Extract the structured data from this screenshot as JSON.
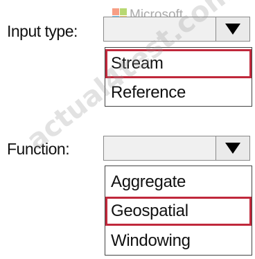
{
  "watermark": {
    "logo_text": "Microsoft",
    "site_text": "actual4test.com"
  },
  "input_type": {
    "label": "Input type:",
    "value": "",
    "options": [
      "Stream",
      "Reference"
    ],
    "selected": "Stream"
  },
  "function": {
    "label": "Function:",
    "value": "",
    "options": [
      "Aggregate",
      "Geospatial",
      "Windowing"
    ],
    "selected": "Geospatial"
  },
  "colors": {
    "highlight": "#c0283b",
    "combo_bg": "#f0f0f0"
  },
  "icons": {
    "dropdown": "triangle-down-icon"
  }
}
